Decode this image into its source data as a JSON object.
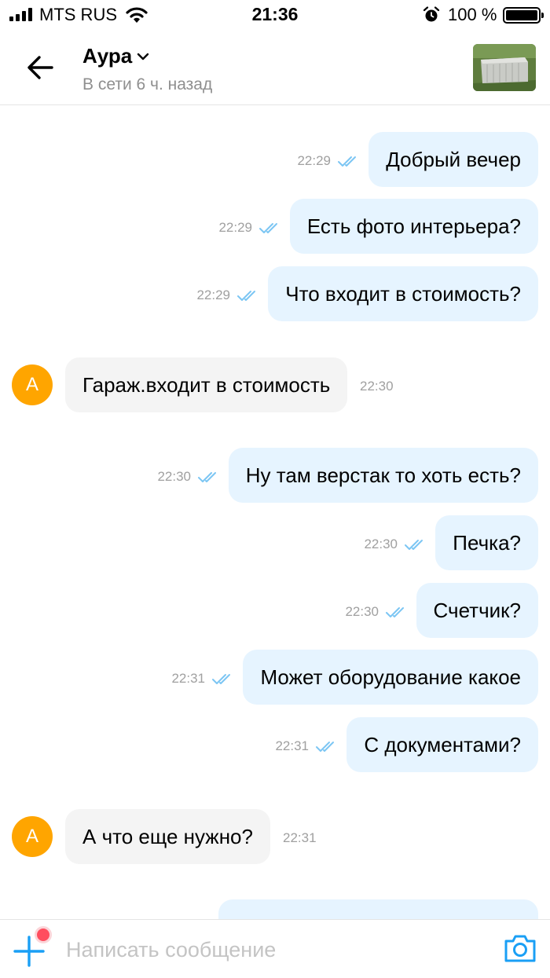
{
  "status_bar": {
    "carrier": "MTS RUS",
    "time": "21:36",
    "battery": "100 %"
  },
  "header": {
    "title": "Аура",
    "subtitle": "В сети 6 ч. назад",
    "back_icon": "arrow-left-icon",
    "dropdown_icon": "chevron-down-icon"
  },
  "messages": [
    {
      "dir": "out",
      "text": "Добрый вечер",
      "time": "22:29",
      "read": true
    },
    {
      "dir": "out",
      "text": "Есть фото интерьера?",
      "time": "22:29",
      "read": true
    },
    {
      "dir": "out",
      "text": "Что входит в стоимость?",
      "time": "22:29",
      "read": true
    },
    {
      "dir": "in",
      "text": "Гараж.входит в стоимость",
      "time": "22:30",
      "avatar": "А"
    },
    {
      "dir": "out",
      "text": "Ну там верстак то хоть есть?",
      "time": "22:30",
      "read": true
    },
    {
      "dir": "out",
      "text": "Печка?",
      "time": "22:30",
      "read": true
    },
    {
      "dir": "out",
      "text": "Счетчик?",
      "time": "22:30",
      "read": true
    },
    {
      "dir": "out",
      "text": "Может оборудование какое",
      "time": "22:31",
      "read": true
    },
    {
      "dir": "out",
      "text": "С документами?",
      "time": "22:31",
      "read": true
    },
    {
      "dir": "in",
      "text": "А что еще нужно?",
      "time": "22:31",
      "avatar": "А"
    }
  ],
  "composer": {
    "placeholder": "Написать сообщение",
    "add_icon": "plus-icon",
    "camera_icon": "camera-icon"
  },
  "colors": {
    "accent": "#1a9ff5",
    "outgoing_bubble": "#e6f4ff",
    "incoming_bubble": "#f4f4f4",
    "avatar": "#ffa500",
    "read_check": "#7cc6f3",
    "notification_dot": "#ff4d5e"
  }
}
